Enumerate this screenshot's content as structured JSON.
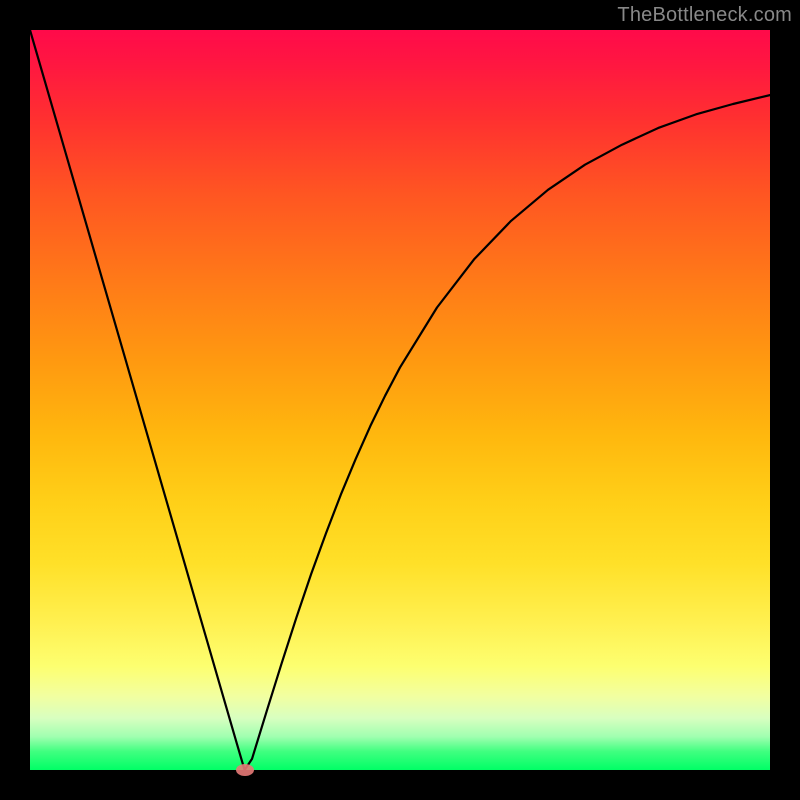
{
  "watermark": "TheBottleneck.com",
  "colors": {
    "frame_background": "#000000",
    "curve_stroke": "#000000",
    "marker_fill": "#e77a78",
    "watermark_text": "#888888",
    "gradient_stops": [
      "#ff0a4a",
      "#ff1840",
      "#ff3030",
      "#ff5522",
      "#ff7a18",
      "#ff9a10",
      "#ffb80e",
      "#ffd018",
      "#ffe028",
      "#fff050",
      "#fdff70",
      "#f2ffa0",
      "#d8ffc0",
      "#a0ffb0",
      "#40ff80",
      "#00ff66"
    ]
  },
  "chart_data": {
    "type": "line",
    "title": "",
    "xlabel": "",
    "ylabel": "",
    "xlim": [
      0,
      100
    ],
    "ylim": [
      0,
      100
    ],
    "grid": false,
    "legend": false,
    "x": [
      0,
      2,
      4,
      6,
      8,
      10,
      12,
      14,
      16,
      18,
      20,
      22,
      24,
      26,
      28,
      29,
      30,
      32,
      34,
      36,
      38,
      40,
      42,
      44,
      46,
      48,
      50,
      55,
      60,
      65,
      70,
      75,
      80,
      85,
      90,
      95,
      100
    ],
    "values": [
      100,
      93.1,
      86.2,
      79.3,
      72.4,
      65.5,
      58.6,
      51.7,
      44.8,
      37.9,
      31.0,
      24.1,
      17.2,
      10.3,
      3.4,
      0,
      1.5,
      8.0,
      14.4,
      20.6,
      26.5,
      32.0,
      37.2,
      42.0,
      46.5,
      50.6,
      54.4,
      62.5,
      69.0,
      74.2,
      78.4,
      81.8,
      84.5,
      86.8,
      88.6,
      90.0,
      91.2
    ],
    "annotations": [
      {
        "type": "marker",
        "x": 29,
        "y": 0,
        "shape": "ellipse",
        "color": "#e77a78"
      }
    ],
    "notes": "V-shaped bottleneck curve. y≈0 (optimal/green) at x≈29; left branch is linear rising to y=100 at x=0; right branch rises with diminishing slope toward y≈91 at x=100. No axis ticks or labels are rendered in the source image; values are read from curve geometry against the gradient background where top=100 and bottom=0."
  }
}
